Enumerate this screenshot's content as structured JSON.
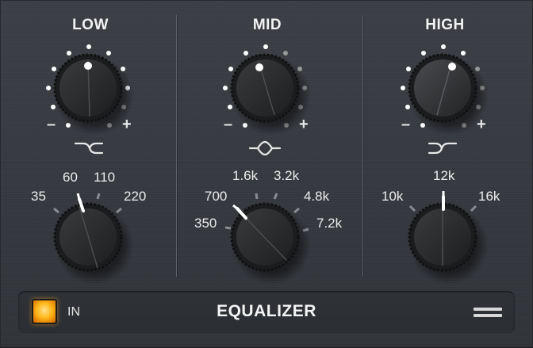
{
  "bands": [
    {
      "id": "low",
      "title": "LOW",
      "gain_minus": "–",
      "gain_plus": "+",
      "gain_value": 0.5,
      "shape": "low-shelf-icon",
      "freq_labels": [
        "35",
        "60",
        "110",
        "220"
      ],
      "freq_selected": "60"
    },
    {
      "id": "mid",
      "title": "MID",
      "gain_minus": "–",
      "gain_plus": "+",
      "gain_value": 0.42,
      "shape": "bell-icon",
      "freq_labels": [
        "350",
        "700",
        "1.6k",
        "3.2k",
        "4.8k",
        "7.2k"
      ],
      "freq_selected": "700"
    },
    {
      "id": "high",
      "title": "HIGH",
      "gain_minus": "–",
      "gain_plus": "+",
      "gain_value": 0.6,
      "shape": "high-shelf-icon",
      "freq_labels": [
        "10k",
        "12k",
        "16k"
      ],
      "freq_selected": "12k"
    }
  ],
  "footer": {
    "in_label": "IN",
    "in_active": true,
    "title": "EQUALIZER",
    "menu_icon": "menu-icon"
  },
  "colors": {
    "panel": "#383b41",
    "led": "#ffb81c",
    "text": "#f2f2f2",
    "dot_lit": "#ffffff",
    "dot_dim": "#9a9a9a"
  }
}
